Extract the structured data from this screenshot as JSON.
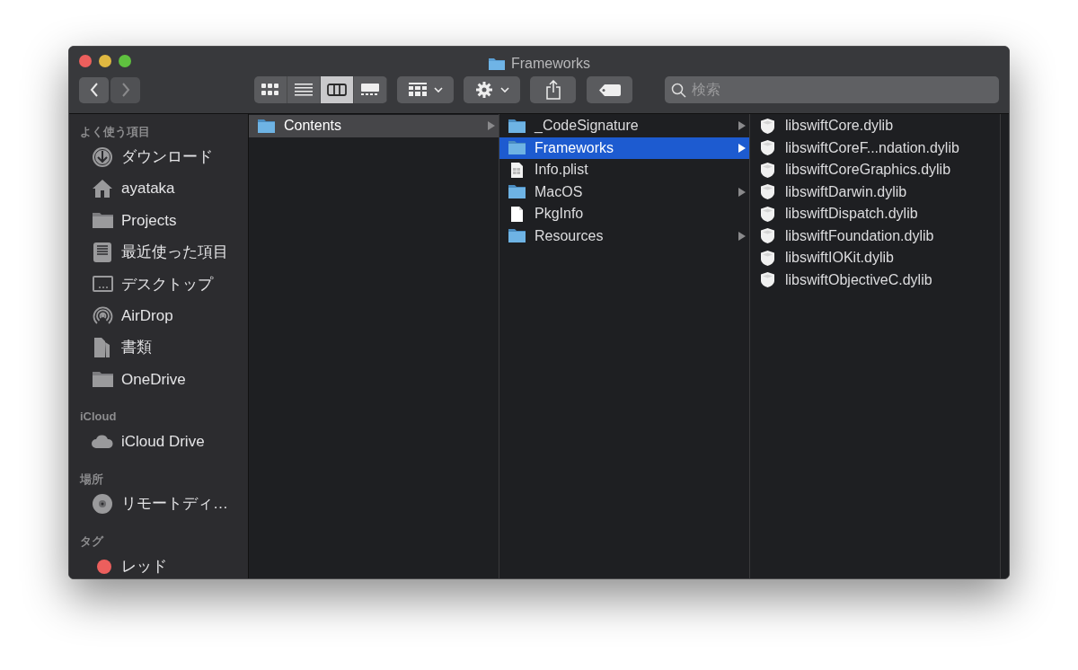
{
  "window": {
    "title": "Frameworks"
  },
  "toolbar": {
    "view_modes": [
      {
        "kind": "icons",
        "selected": false
      },
      {
        "kind": "list",
        "selected": false
      },
      {
        "kind": "columns",
        "selected": true
      },
      {
        "kind": "gallery",
        "selected": false
      }
    ],
    "search": {
      "placeholder": "検索"
    }
  },
  "sidebar": {
    "sections": [
      {
        "title": "よく使う項目",
        "items": [
          {
            "label": "ダウンロード",
            "kind": "download"
          },
          {
            "label": "ayataka",
            "kind": "home"
          },
          {
            "label": "Projects",
            "kind": "folder"
          },
          {
            "label": "最近使った項目",
            "kind": "recents"
          },
          {
            "label": "デスクトップ",
            "kind": "desktop"
          },
          {
            "label": "AirDrop",
            "kind": "airdrop"
          },
          {
            "label": "書類",
            "kind": "documents"
          },
          {
            "label": "OneDrive",
            "kind": "folder"
          }
        ]
      },
      {
        "title": "iCloud",
        "items": [
          {
            "label": "iCloud Drive",
            "kind": "cloud"
          }
        ]
      },
      {
        "title": "場所",
        "items": [
          {
            "label": "リモートディ…",
            "kind": "disc"
          }
        ]
      },
      {
        "title": "タグ",
        "items": [
          {
            "label": "レッド",
            "kind": "tag",
            "color": "#ec5f5d"
          }
        ]
      }
    ]
  },
  "columns": [
    {
      "active": false,
      "items": [
        {
          "label": "Contents",
          "kind": "folder",
          "has_children": true,
          "selected": true
        }
      ]
    },
    {
      "active": true,
      "items": [
        {
          "label": "_CodeSignature",
          "kind": "folder",
          "has_children": true,
          "selected": false
        },
        {
          "label": "Frameworks",
          "kind": "folder",
          "has_children": true,
          "selected": true
        },
        {
          "label": "Info.plist",
          "kind": "plist",
          "has_children": false,
          "selected": false
        },
        {
          "label": "MacOS",
          "kind": "folder",
          "has_children": true,
          "selected": false
        },
        {
          "label": "PkgInfo",
          "kind": "file",
          "has_children": false,
          "selected": false
        },
        {
          "label": "Resources",
          "kind": "folder",
          "has_children": true,
          "selected": false
        }
      ]
    },
    {
      "items": [
        {
          "label": "libswiftCore.dylib",
          "kind": "dylib",
          "has_children": false,
          "selected": false
        },
        {
          "label": "libswiftCoreF...ndation.dylib",
          "kind": "dylib",
          "has_children": false,
          "selected": false
        },
        {
          "label": "libswiftCoreGraphics.dylib",
          "kind": "dylib",
          "has_children": false,
          "selected": false
        },
        {
          "label": "libswiftDarwin.dylib",
          "kind": "dylib",
          "has_children": false,
          "selected": false
        },
        {
          "label": "libswiftDispatch.dylib",
          "kind": "dylib",
          "has_children": false,
          "selected": false
        },
        {
          "label": "libswiftFoundation.dylib",
          "kind": "dylib",
          "has_children": false,
          "selected": false
        },
        {
          "label": "libswiftIOKit.dylib",
          "kind": "dylib",
          "has_children": false,
          "selected": false
        },
        {
          "label": "libswiftObjectiveC.dylib",
          "kind": "dylib",
          "has_children": false,
          "selected": false
        }
      ]
    }
  ]
}
